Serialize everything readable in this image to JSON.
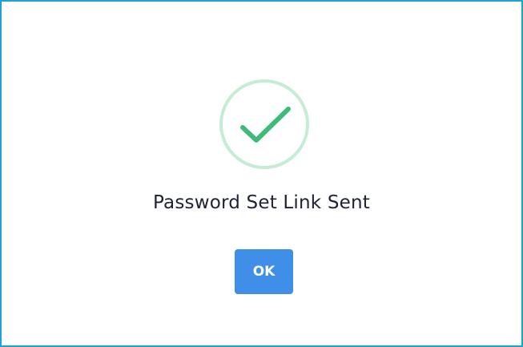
{
  "dialog": {
    "icon": "success-check-icon",
    "title": "Password Set Link Sent",
    "ok_label": "OK"
  },
  "colors": {
    "border": "#1aa3d4",
    "icon_ring": "#c6ecd6",
    "checkmark": "#3dbb78",
    "title_text": "#1f2235",
    "button_bg": "#3f8ee8",
    "button_text": "#ffffff"
  }
}
